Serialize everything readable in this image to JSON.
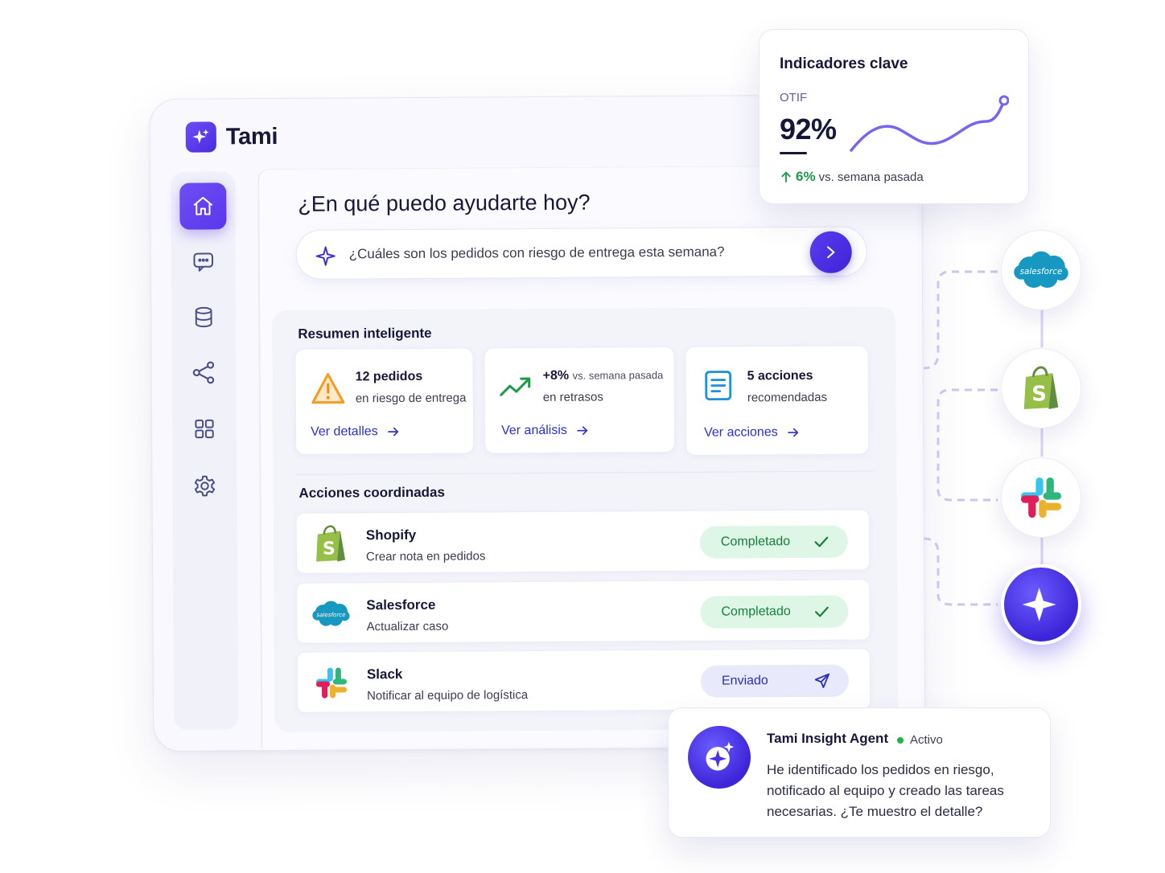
{
  "app": {
    "name": "Tami"
  },
  "sidebar": {
    "items": [
      {
        "icon": "home-icon",
        "active": true
      },
      {
        "icon": "chat-icon",
        "active": false
      },
      {
        "icon": "database-icon",
        "active": false
      },
      {
        "icon": "share-icon",
        "active": false
      },
      {
        "icon": "grid-icon",
        "active": false
      },
      {
        "icon": "settings-icon",
        "active": false
      }
    ]
  },
  "main": {
    "title": "¿En qué puedo ayudarte hoy?",
    "search": {
      "query": "¿Cuáles son los pedidos con riesgo de entrega esta semana?"
    }
  },
  "summary": {
    "title": "Resumen inteligente",
    "cards": [
      {
        "icon": "warning-icon",
        "title": "12 pedidos",
        "subtitle": "en riesgo de entrega",
        "link": "Ver detalles"
      },
      {
        "icon": "trend-up-icon",
        "title": "+8%",
        "title_suffix": "vs. semana pasada",
        "subtitle": "en retrasos",
        "link": "Ver análisis"
      },
      {
        "icon": "document-icon",
        "title": "5 acciones",
        "subtitle": "recomendadas",
        "link": "Ver acciones"
      }
    ]
  },
  "actions": {
    "title": "Acciones coordinadas",
    "rows": [
      {
        "app": "Shopify",
        "description": "Crear nota en pedidos",
        "status": "Completado",
        "status_icon": "check-icon"
      },
      {
        "app": "Salesforce",
        "description": "Actualizar caso",
        "status": "Completado",
        "status_icon": "check-icon"
      },
      {
        "app": "Slack",
        "description": "Notificar al equipo de logística",
        "status": "Enviado",
        "status_icon": "send-icon"
      }
    ]
  },
  "kpi": {
    "title": "Indicadores clave",
    "label": "OTIF",
    "value": "92%",
    "change": "6%",
    "change_text": "vs. semana pasada"
  },
  "integrations": {
    "salesforce_logo_text": "salesforce",
    "items": [
      "Salesforce",
      "Shopify",
      "Slack",
      "Tami"
    ]
  },
  "agent": {
    "name": "Tami Insight Agent",
    "status": "Activo",
    "message": "He identificado los pedidos en riesgo, notificado al equipo y creado las tareas necesarias. ¿Te muestro el detalle?"
  },
  "colors": {
    "primary": "#5a36ea",
    "success": "#1e9a4a",
    "link": "#2a2fd6",
    "chart_line": "#7a63ef"
  }
}
